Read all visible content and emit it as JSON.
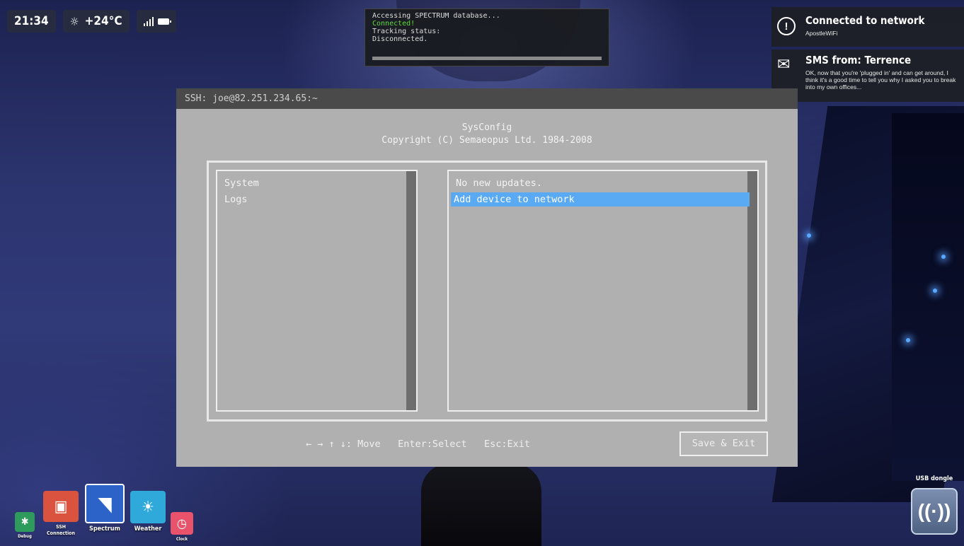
{
  "status_bar": {
    "time": "21:34",
    "weather": "+24°C",
    "weather_icon": "cloud-sun-icon",
    "signal_icon": "signal-icon",
    "battery_icon": "battery-icon"
  },
  "tracking": {
    "line1": "Accessing SPECTRUM database...",
    "line2": "Connected!",
    "line3": "Tracking status:",
    "line4": "Disconnected."
  },
  "notifications": [
    {
      "icon": "alert-icon",
      "title": "Connected to network",
      "body": "ApostleWiFi"
    },
    {
      "icon": "envelope-icon",
      "title": "SMS from: Terrence",
      "body": "OK, now that you're 'plugged in' and can get around, I think it's a good time to tell you why I asked you to break into my own offices..."
    }
  ],
  "ssh": {
    "header": "SSH: joe@82.251.234.65:~",
    "title": "SysConfig",
    "copyright": "Copyright (C) Semaeopus Ltd. 1984-2008",
    "left_items": [
      "System",
      "Logs"
    ],
    "right_items": [
      "No new updates.",
      "Add device to network"
    ],
    "selected_right_index": 1,
    "hint_move": "← → ↑ ↓: Move",
    "hint_select": "Enter:Select",
    "hint_exit": "Esc:Exit",
    "save_button": "Save & Exit"
  },
  "dock": {
    "apps": [
      {
        "label": "Debug",
        "color": "#2e9a5c",
        "icon": "bug-icon"
      },
      {
        "label": "SSH Connection",
        "color": "#d9533f",
        "icon": "terminal-icon"
      },
      {
        "label": "Spectrum",
        "color": "#2b63c9",
        "icon": "spectrum-icon"
      },
      {
        "label": "Weather",
        "color": "#2fa9d9",
        "icon": "weather-icon"
      },
      {
        "label": "Clock",
        "color": "#e8536b",
        "icon": "clock-icon"
      }
    ]
  },
  "usb": {
    "label": "USB dongle",
    "icon": "usb-dongle-icon"
  }
}
